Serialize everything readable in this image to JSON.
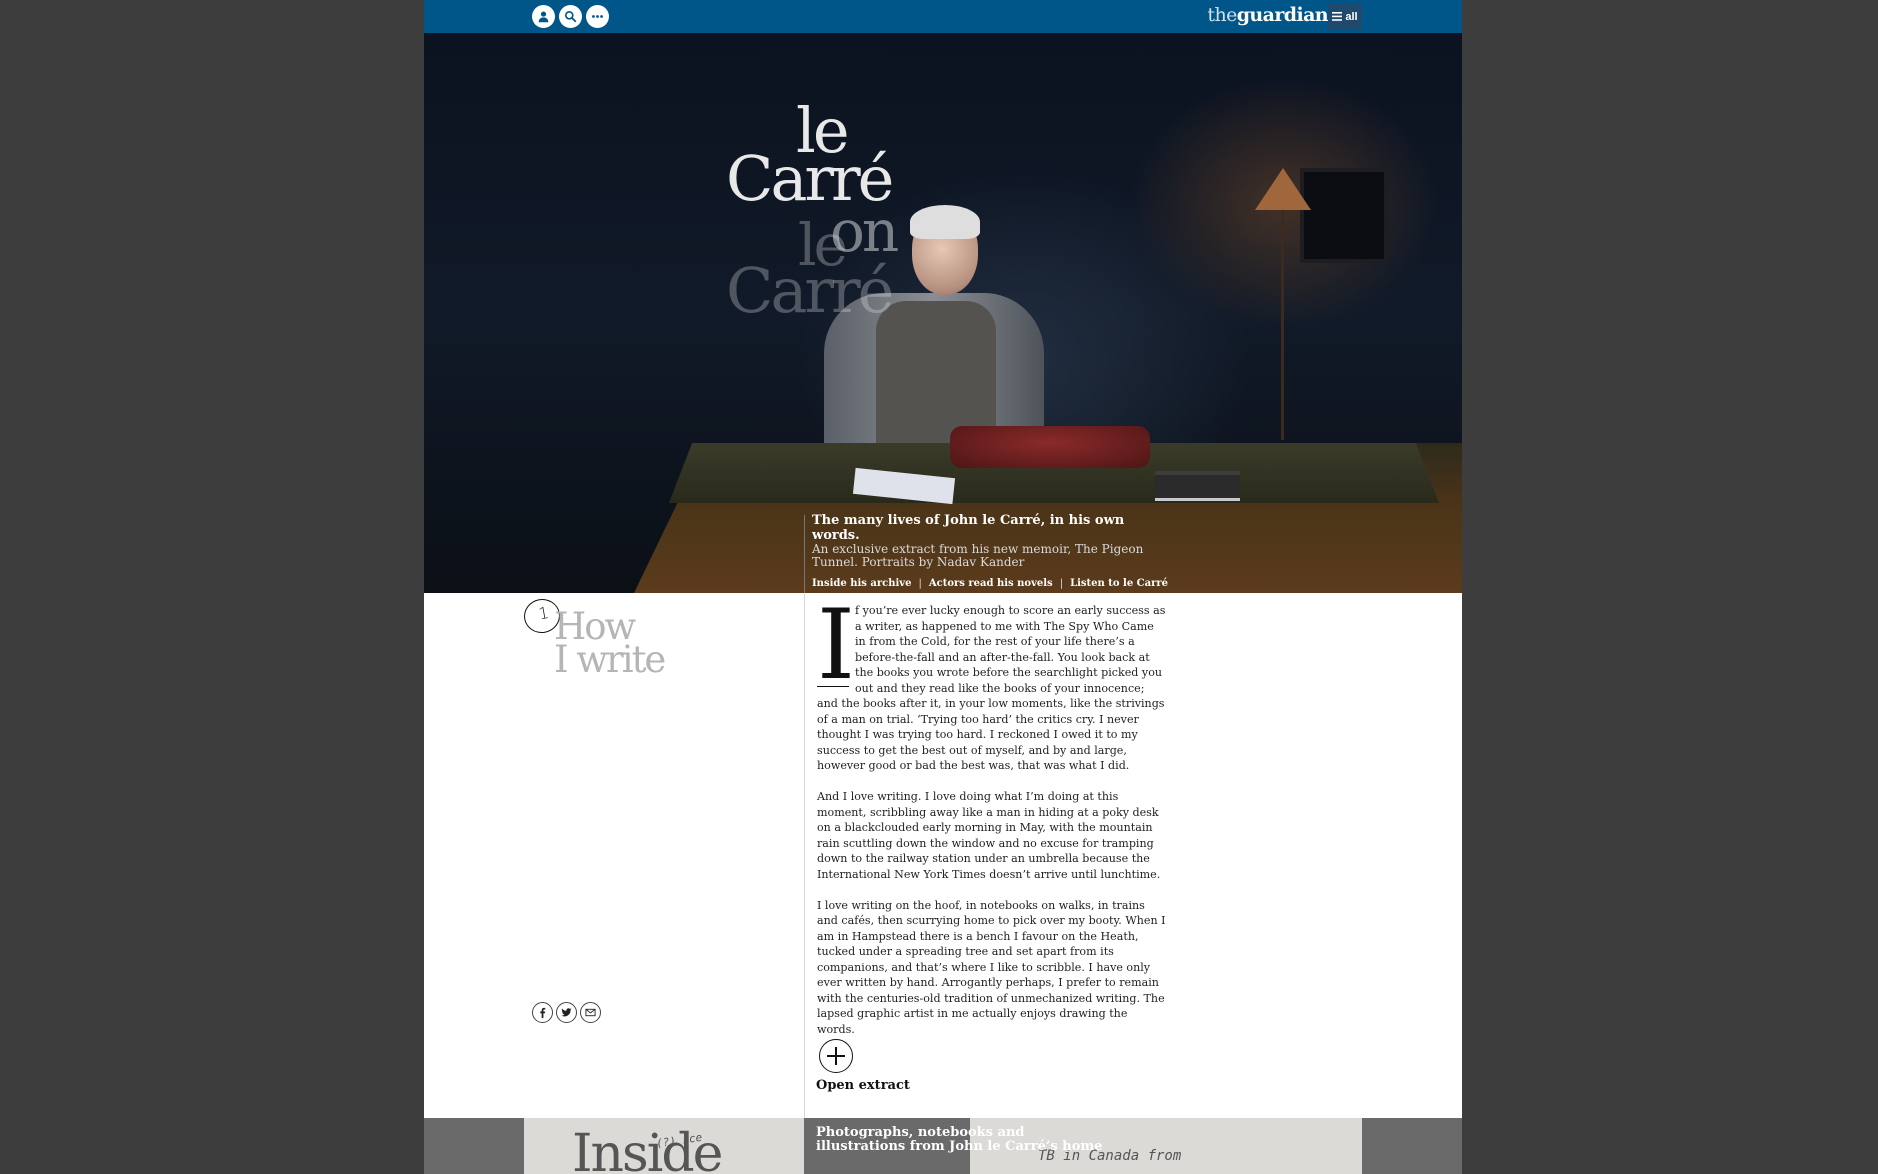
{
  "header": {
    "brand_prefix": "the",
    "brand_name": "guardian",
    "menu_label": "all",
    "icons": [
      "profile-icon",
      "search-icon",
      "more-icon",
      "menu-icon"
    ]
  },
  "hero": {
    "title_lines": [
      "le",
      "Carré",
      "on",
      "le",
      "Carré"
    ],
    "caption_title": "The many lives of John le Carré, in his own words.",
    "caption_subtitle": "An exclusive extract from his new memoir, The Pigeon Tunnel. Portraits by Nadav Kander",
    "links": [
      "Inside his archive",
      "Actors read his novels",
      "Listen to le Carré"
    ],
    "link_separator": "|"
  },
  "section": {
    "number": "1",
    "title_line1": "How",
    "title_line2": "I write"
  },
  "article": {
    "dropcap": "I",
    "para1": "f you’re ever lucky enough to score an early success as a writer, as happened to me with The Spy Who Came in from the Cold, for the rest of your life there’s a before-the-fall and an after-the-fall. You look back at the books you wrote before the searchlight picked you out and they read like the books of your innocence; and the books after it, in your low moments, like the strivings of a man on trial. ‘Trying too hard’ the critics cry. I never thought I was trying too hard. I reckoned I owed it to my success to get the best out of myself, and by and large, however good or bad the best was, that was what I did.",
    "para2": "And I love writing. I love doing what I’m doing at this moment, scribbling away like a man in hiding at a poky desk on a blackclouded early morning in May, with the mountain rain scuttling down the window and no excuse for tramping down to the railway station under an umbrella because the International New York Times doesn’t arrive until lunchtime.",
    "para3": "I love writing on the hoof, in notebooks on walks, in trains and cafés, then scurrying home to pick over my booty. When I am in Hampstead there is a bench I favour on the Heath, tucked under a spreading tree and set apart from its companions, and that’s where I like to scribble. I have only ever written by hand. Arrogantly perhaps, I prefer to remain with the centuries-old tradition of unmechanized writing. The lapsed graphic artist in me actually enjoys drawing the words."
  },
  "share": [
    "facebook-icon",
    "twitter-icon",
    "email-icon"
  ],
  "open_extract": {
    "label": "Open extract"
  },
  "next_section": {
    "caption": "Photographs, notebooks and illustrations from John le Carré’s home",
    "image_word": "Inside",
    "scribble_left": "(?)  sce",
    "scribble_right": "TB in Canada from"
  },
  "colors": {
    "brand_blue": "#005689",
    "page_bg": "#3d3d3d",
    "title_grey": "#b5b5b5"
  }
}
